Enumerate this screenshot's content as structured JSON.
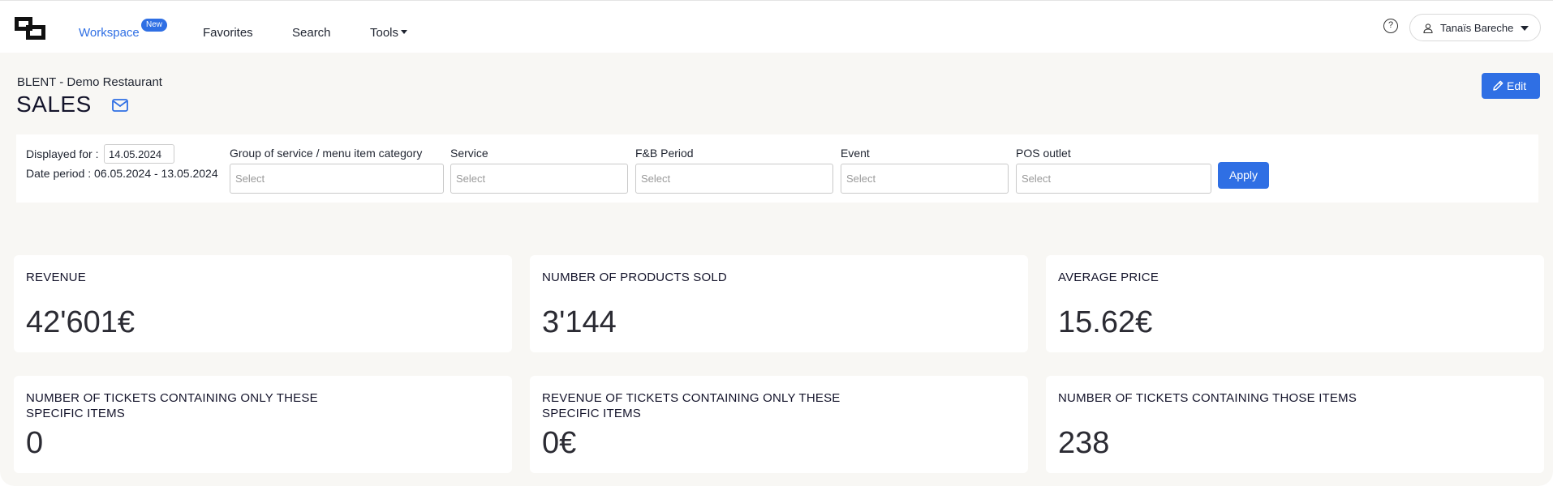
{
  "navbar": {
    "items": [
      {
        "label": "Workspace",
        "badge": "New"
      },
      {
        "label": "Favorites"
      },
      {
        "label": "Search"
      },
      {
        "label": "Tools"
      }
    ],
    "help_icon": "?",
    "user": {
      "name": "Tanaïs Bareche"
    }
  },
  "header": {
    "subtitle": "BLENT - Demo Restaurant",
    "title": "SALES",
    "edit_label": "Edit"
  },
  "filters": {
    "displayed_label": "Displayed for :",
    "displayed_date": "14.05.2024",
    "period_text": "Date period : 06.05.2024 - 13.05.2024",
    "fields": [
      {
        "label": "Group of service / menu item category",
        "placeholder": "Select"
      },
      {
        "label": "Service",
        "placeholder": "Select"
      },
      {
        "label": "F&B Period",
        "placeholder": "Select"
      },
      {
        "label": "Event",
        "placeholder": "Select"
      },
      {
        "label": "POS outlet",
        "placeholder": "Select"
      }
    ],
    "apply_label": "Apply"
  },
  "kpis": [
    {
      "title": "REVENUE",
      "value": "42'601€"
    },
    {
      "title": "NUMBER OF PRODUCTS SOLD",
      "value": "3'144"
    },
    {
      "title": "AVERAGE PRICE",
      "value": "15.62€"
    },
    {
      "title": "NUMBER OF TICKETS CONTAINING ONLY THESE SPECIFIC ITEMS",
      "value": "0"
    },
    {
      "title": "REVENUE OF TICKETS CONTAINING ONLY THESE SPECIFIC ITEMS",
      "value": "0€"
    },
    {
      "title": "NUMBER OF TICKETS CONTAINING THOSE ITEMS",
      "value": "238"
    }
  ],
  "colors": {
    "accent": "#2f6fe4",
    "background": "#f8f7f4",
    "card": "#ffffff",
    "text": "#14142b"
  },
  "icons": [
    "app-logo-icon",
    "help-icon",
    "user-icon",
    "chevron-down-icon",
    "mail-icon",
    "pencil-icon"
  ]
}
